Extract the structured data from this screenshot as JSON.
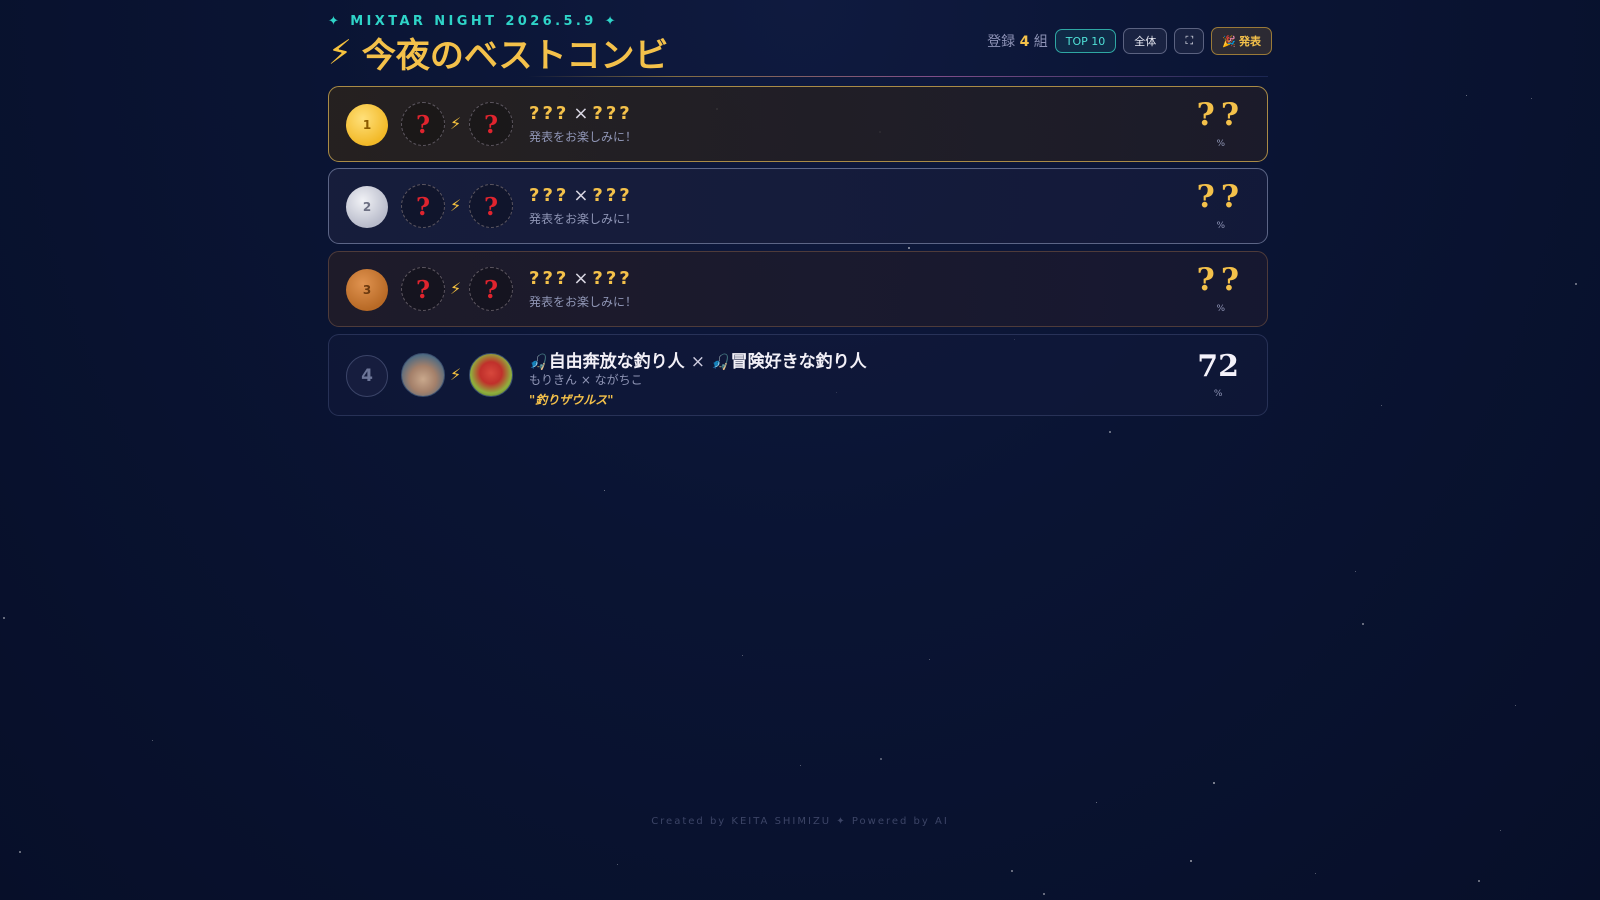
{
  "header": {
    "event_label": "✦ MIXTAR NIGHT 2026.5.9 ✦",
    "title_icon": "⚡",
    "title": "今夜のベストコンビ"
  },
  "controls": {
    "registered_prefix": "登録",
    "registered_count": "4",
    "registered_suffix": "組",
    "top10_label": "TOP 10",
    "all_label": "全体",
    "fullscreen_icon": "⛶",
    "announce_icon": "🎉",
    "announce_label": "発表"
  },
  "rows": [
    {
      "medal": "1",
      "avatar_a": "?",
      "avatar_b": "?",
      "bolt": "⚡",
      "name_a": "???",
      "cross": "×",
      "name_b": "???",
      "subtitle": "発表をお楽しみに！",
      "score": "??",
      "unit": "%"
    },
    {
      "medal": "2",
      "avatar_a": "?",
      "avatar_b": "?",
      "bolt": "⚡",
      "name_a": "???",
      "cross": "×",
      "name_b": "???",
      "subtitle": "発表をお楽しみに！",
      "score": "??",
      "unit": "%"
    },
    {
      "medal": "3",
      "avatar_a": "?",
      "avatar_b": "?",
      "bolt": "⚡",
      "name_a": "???",
      "cross": "×",
      "name_b": "???",
      "subtitle": "発表をお楽しみに！",
      "score": "??",
      "unit": "%"
    },
    {
      "rank": "4",
      "bolt": "⚡",
      "name_a_icon": "🎣",
      "name_a": "自由奔放な釣り人",
      "cross": "×",
      "name_b_icon": "🎣",
      "name_b": "冒険好きな釣り人",
      "members": "もりきん × ながちこ",
      "team_name": "\"釣りザウルス\"",
      "score": "72",
      "unit": "%"
    }
  ],
  "footer": "Created by KEITA SHIMIZU ✦ Powered by AI",
  "colors": {
    "background": "#0a1433",
    "accent_gold": "#f4c14a",
    "accent_teal": "#2fd4c8",
    "unknown_red": "#e0242e"
  }
}
